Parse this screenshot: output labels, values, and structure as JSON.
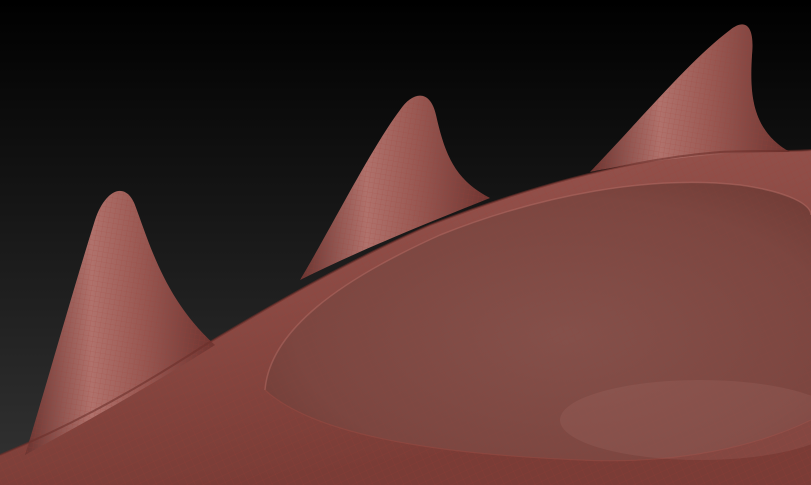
{
  "scene": {
    "subject": "sculpted-mesh-with-spikes",
    "colors": {
      "background_top": "#000000",
      "background_bottom": "#333333",
      "mesh_base": "#8a4a44",
      "mesh_light": "#b0706a",
      "mesh_dark": "#5a2a26",
      "wireframe": "#9a3a30",
      "basin": "#7e4843"
    }
  }
}
